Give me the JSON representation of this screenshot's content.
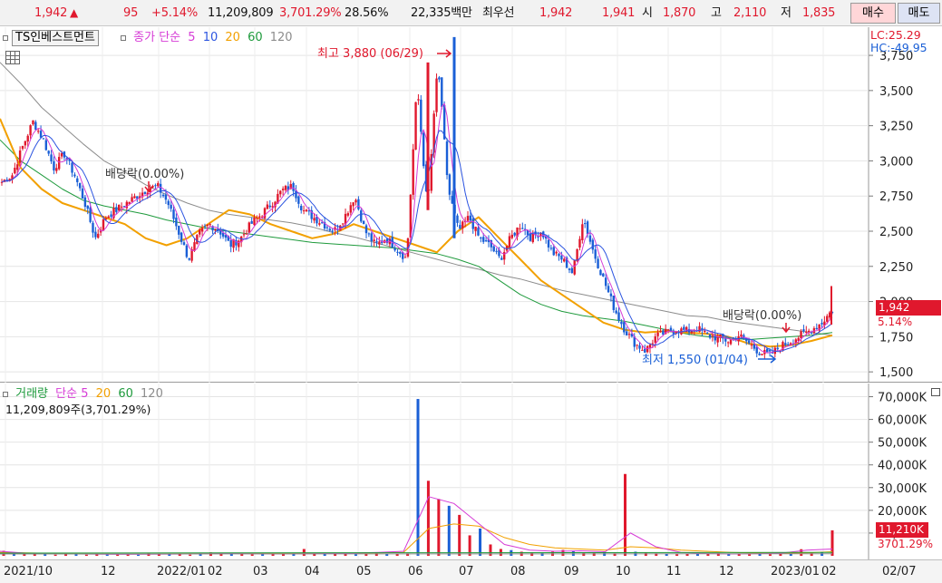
{
  "quote": {
    "price": "1,942",
    "arrow": "▲",
    "change": "95",
    "change_pct": "+5.14%",
    "volume": "11,209,809",
    "volume_ratio": "3,701.29%",
    "turnover": "28.56%",
    "amount": "22,335백만",
    "bid_label": "최우선",
    "ask": "1,942",
    "bid": "1,941",
    "open_label": "시",
    "open": "1,870",
    "high_label": "고",
    "high": "2,110",
    "low_label": "저",
    "low": "1,835",
    "buy_label": "매수",
    "sell_label": "매도"
  },
  "price_panel": {
    "ticker": "TS인베스트먼트",
    "legend_price": "종가 단순",
    "ma_labels": [
      "5",
      "10",
      "20",
      "60",
      "120"
    ],
    "ma_colors": [
      "#d63cd6",
      "#2b54e0",
      "#f2a000",
      "#1e9a3c",
      "#8c8c8c"
    ],
    "lc": "LC:25.29",
    "hc": "HC:-49.95",
    "last_price": "1,942",
    "last_pct": "5.14%",
    "annot_high": "최고 3,880 (06/29)",
    "annot_low": "최저 1,550 (01/04)",
    "annot_div1": "배당락(0.00%)",
    "annot_div2": "배당락(0.00%)"
  },
  "volume_panel": {
    "legend_vol": "거래량",
    "legend_simple": "단순",
    "ma_labels": [
      "5",
      "20",
      "60",
      "120"
    ],
    "ma_colors": [
      "#d63cd6",
      "#f2a000",
      "#1e9a3c",
      "#8c8c8c"
    ],
    "vol_text": "11,209,809주(3,701.29%)",
    "last_vol": "11,210K",
    "last_vol_pct": "3701.29%"
  },
  "x_labels": [
    "2021/10",
    "12",
    "2022/01",
    "02",
    "03",
    "04",
    "05",
    "06",
    "07",
    "08",
    "09",
    "10",
    "11",
    "12",
    "2023/01",
    "02",
    "02/07"
  ],
  "chart_data": {
    "type": "candlestick",
    "y_ticks": [
      1500,
      1750,
      2000,
      2250,
      2500,
      2750,
      3000,
      3250,
      3500,
      3750
    ],
    "y_tick_labels": [
      "1,500",
      "1,750",
      "2,000",
      "2,250",
      "2,500",
      "2,750",
      "3,000",
      "3,250",
      "3,500",
      "3,750"
    ],
    "volume_ticks": [
      "10,000K",
      "20,000K",
      "30,000K",
      "40,000K",
      "50,000K",
      "60,000K",
      "70,000K"
    ],
    "volume_tick_values": [
      10000,
      20000,
      30000,
      40000,
      50000,
      60000,
      70000
    ],
    "ylim": [
      1430,
      3860
    ],
    "vol_ylim": [
      0,
      75000
    ],
    "close_path": [
      2850,
      2900,
      3100,
      3280,
      3150,
      2950,
      3050,
      2900,
      2700,
      2450,
      2600,
      2650,
      2700,
      2750,
      2800,
      2820,
      2700,
      2500,
      2300,
      2480,
      2550,
      2500,
      2400,
      2450,
      2550,
      2620,
      2700,
      2790,
      2820,
      2650,
      2600,
      2550,
      2500,
      2600,
      2750,
      2500,
      2400,
      2450,
      2380,
      2300,
      3550,
      2650,
      3700,
      2800,
      2500,
      2600,
      2450,
      2400,
      2300,
      2450,
      2550,
      2450,
      2500,
      2350,
      2300,
      2200,
      2600,
      2350,
      2150,
      1950,
      1800,
      1700,
      1650,
      1750,
      1780,
      1800,
      1790,
      1810,
      1760,
      1740,
      1720,
      1760,
      1700,
      1640,
      1620,
      1680,
      1720,
      1760,
      1800,
      1850,
      1942
    ],
    "ma120_path": [
      3700,
      3550,
      3380,
      3250,
      3120,
      3000,
      2920,
      2830,
      2760,
      2700,
      2650,
      2620,
      2600,
      2580,
      2560,
      2530,
      2490,
      2460,
      2420,
      2380,
      2340,
      2300,
      2260,
      2230,
      2190,
      2160,
      2120,
      2080,
      2050,
      2020,
      1990,
      1960,
      1930,
      1900,
      1890,
      1860,
      1840,
      1820,
      1800,
      1780,
      1760
    ],
    "ma60_path": [
      3150,
      3000,
      2900,
      2800,
      2720,
      2680,
      2650,
      2620,
      2580,
      2550,
      2520,
      2500,
      2480,
      2460,
      2440,
      2420,
      2410,
      2400,
      2390,
      2380,
      2360,
      2340,
      2300,
      2250,
      2150,
      2050,
      1980,
      1930,
      1900,
      1880,
      1860,
      1830,
      1800,
      1770,
      1750,
      1740,
      1730,
      1740,
      1750,
      1760,
      1780
    ],
    "ma20_path": [
      3300,
      2950,
      2800,
      2700,
      2650,
      2600,
      2550,
      2450,
      2400,
      2450,
      2550,
      2650,
      2620,
      2550,
      2500,
      2450,
      2480,
      2550,
      2500,
      2450,
      2400,
      2350,
      2500,
      2600,
      2450,
      2300,
      2150,
      2050,
      1950,
      1850,
      1800,
      1780,
      1790,
      1780,
      1770,
      1750,
      1700,
      1680,
      1690,
      1720,
      1760
    ],
    "volume_bars": [
      2200,
      1500,
      900,
      1200,
      700,
      500,
      800,
      600,
      500,
      700,
      900,
      800,
      600,
      500,
      1200,
      800,
      700,
      600,
      500,
      700,
      1500,
      900,
      800,
      1100,
      600,
      700,
      800,
      1200,
      800,
      3000,
      1200,
      1400,
      900,
      800,
      700,
      900,
      1500,
      800,
      1000,
      1100,
      69000,
      33000,
      25000,
      22000,
      18000,
      9000,
      12000,
      5000,
      3000,
      2500,
      1800,
      1500,
      1200,
      1800,
      2600,
      2200,
      1400,
      1200,
      1800,
      1100,
      36000,
      1800,
      1300,
      1100,
      900,
      700,
      800,
      1000,
      900,
      1200,
      800,
      700,
      600,
      900,
      700,
      1000,
      800,
      2900,
      1200,
      1800,
      11210
    ],
    "vol_ma5_path": [
      2000,
      1200,
      900,
      800,
      700,
      650,
      700,
      750,
      900,
      1000,
      900,
      800,
      900,
      1000,
      1200,
      1500,
      2000,
      26000,
      23000,
      14000,
      5000,
      2500,
      2000,
      2200,
      1800,
      10000,
      4000,
      1500,
      1000,
      800,
      900,
      1200,
      2500,
      3000
    ],
    "vol_ma20_path": [
      1500,
      1300,
      1100,
      950,
      900,
      850,
      850,
      900,
      950,
      1000,
      1000,
      1000,
      1050,
      1100,
      1200,
      1300,
      1500,
      12000,
      14000,
      13000,
      8000,
      5000,
      3500,
      3000,
      2500,
      4000,
      3500,
      2500,
      2000,
      1500,
      1200,
      1100,
      1300,
      1800
    ]
  }
}
